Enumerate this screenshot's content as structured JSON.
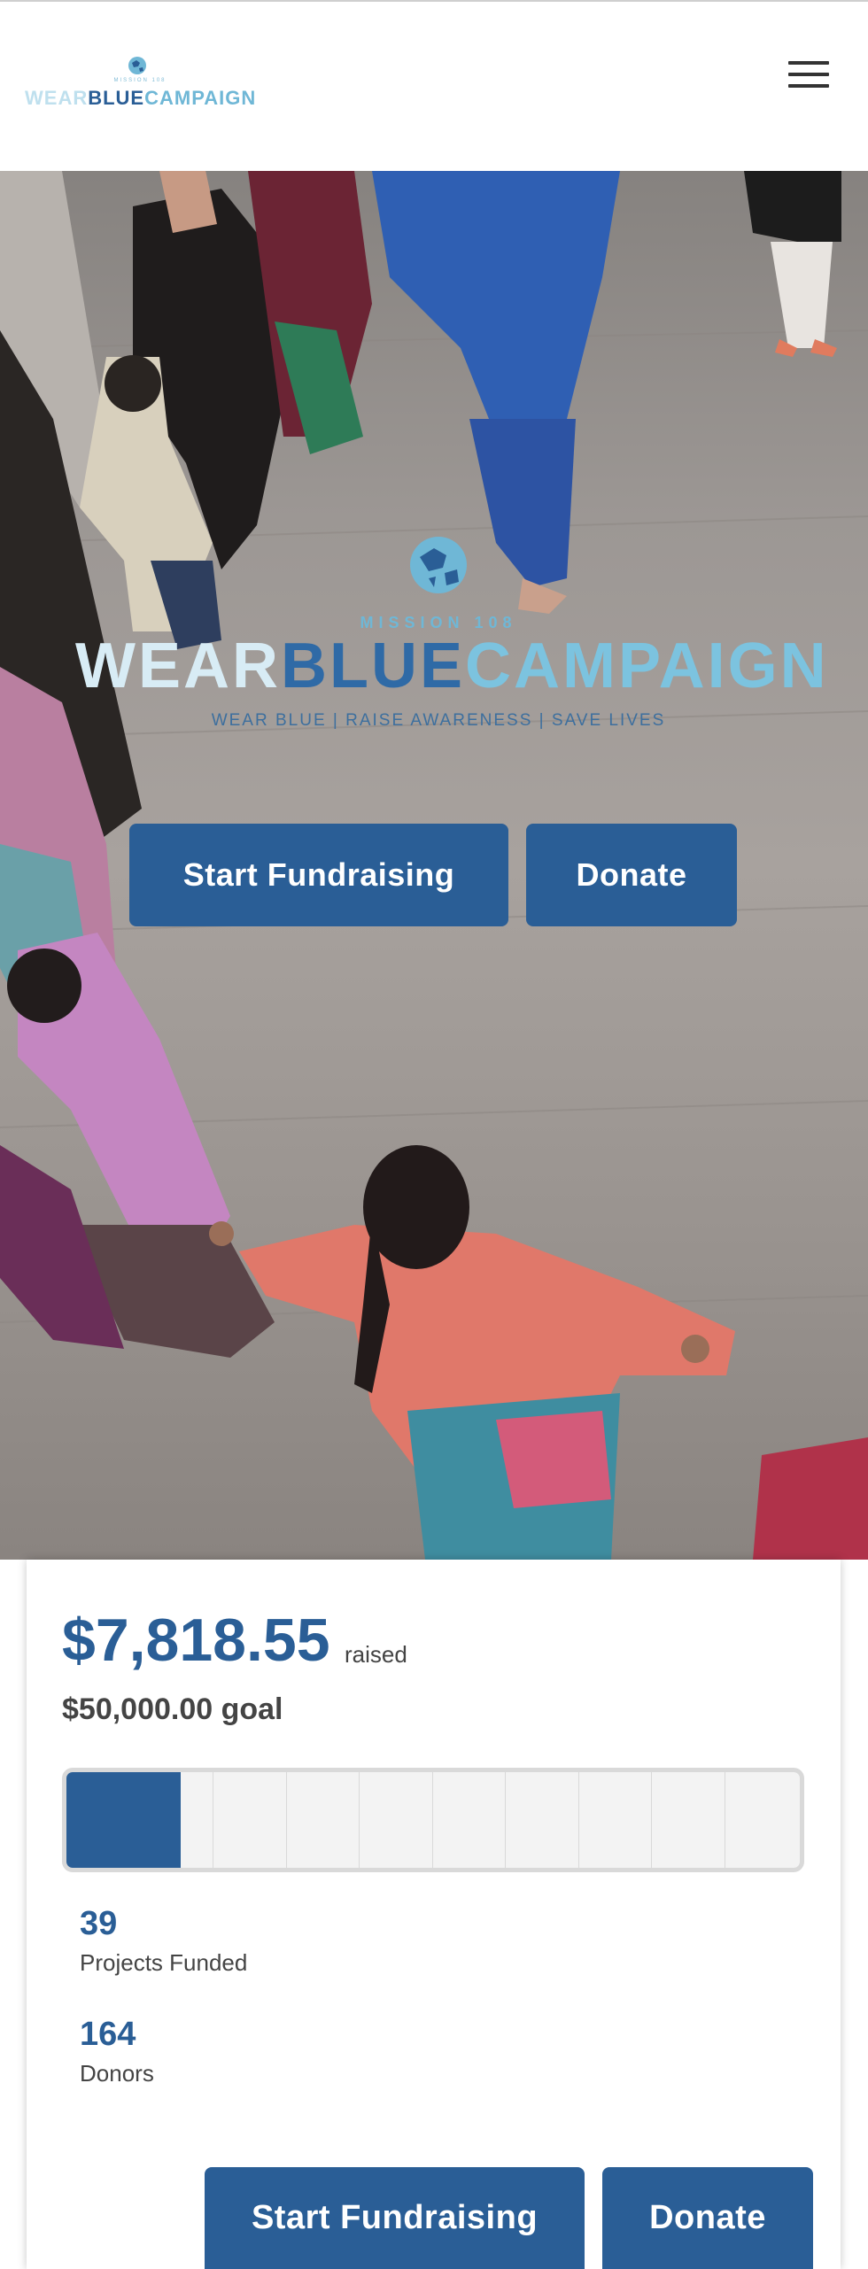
{
  "header": {
    "logo": {
      "small_text": "MISSION 108",
      "word_part1": "WEAR",
      "word_part2": "BLUE",
      "word_part3": "CAMPAIGN"
    },
    "menu_icon": "hamburger-menu-icon"
  },
  "hero": {
    "logo": {
      "mission": "MISSION 108",
      "word_part1": "WEAR",
      "word_part2": "BLUE",
      "word_part3": "CAMPAIGN",
      "tagline": "WEAR BLUE | RAISE AWARENESS | SAVE LIVES"
    },
    "start_fundraising_label": "Start Fundraising",
    "donate_label": "Donate"
  },
  "stats": {
    "raised_amount": "$7,818.55",
    "raised_label": "raised",
    "goal_text": "$50,000.00 goal",
    "progress_fraction": 0.156,
    "projects_count": "39",
    "projects_label": "Projects Funded",
    "donors_count": "164",
    "donors_label": "Donors",
    "start_fundraising_label": "Start Fundraising",
    "donate_label": "Donate"
  },
  "colors": {
    "brand_blue": "#2a5e96",
    "light_blue": "#6fb7d6",
    "text_gray": "#444444"
  }
}
